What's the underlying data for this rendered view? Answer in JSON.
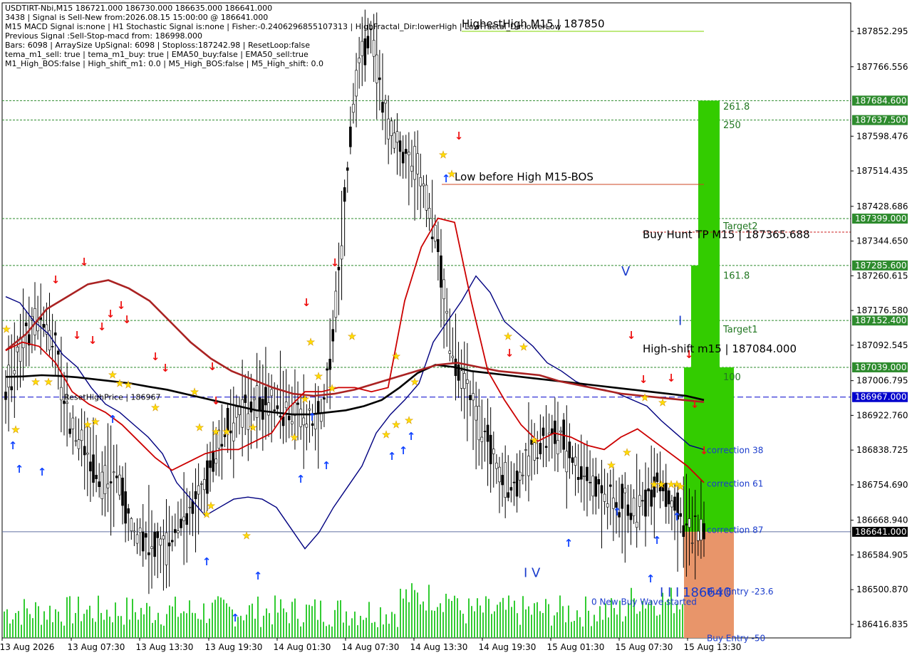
{
  "info_panel": [
    "USDTIRT-Nbi,M15  186721.000 186730.000 186635.000 186641.000",
    "3438 | Signal is Sell-New from:2026.08.15 15:00:00 @ 186641.000",
    "M15 MACD Signal is:none | H1 Stochastic Signal is:none | Fisher:-0.2406296855107313 | HighFractal_Dir:lowerHigh | LowFractal_Dir:lowerLow",
    "Previous Signal :Sell-Stop-macd from: 186998.000",
    "Bars: 6098 | ArraySize UpSignal: 6098 | Stoploss:187242.98 | ResetLoop:false",
    "tema_m1_sell: true | tema_m1_buy: true | EMA50_buy:false | EMA50_sell:true",
    "M1_High_BOS:false | High_shift_m1: 0.0 | M5_High_BOS:false | M5_High_shift: 0.0"
  ],
  "colors": {
    "background": "#ffffff",
    "grid_green": "#2e8b2e",
    "current_price_tag": "#000000",
    "ref_price_tag": "#0000cc",
    "target_tag": "#2e8b2e",
    "candle": "#000000",
    "ema_red": "#cc0000",
    "ema_dark_red": "#aa2222",
    "ema_blue": "#000080",
    "ema_black": "#000000",
    "volume": "#33cc33",
    "buy_arrow": "#1144ff",
    "sell_arrow": "#ee1111",
    "star": "#ffdd00",
    "fib_green": "#33cc00",
    "fib_orange": "#e8956a"
  },
  "icons": {
    "buy_arrow": "up-arrow-icon",
    "sell_arrow": "down-arrow-icon",
    "fractal_star": "star-icon"
  },
  "chart_data": {
    "type": "candlestick",
    "symbol": "USDTIRT-Nbi",
    "timeframe": "M15",
    "ylim": [
      186380,
      187930
    ],
    "y_ticks": [
      187852.295,
      187766.556,
      187598.476,
      187514.435,
      187428.686,
      187344.65,
      187260.615,
      187176.58,
      187092.545,
      187006.795,
      186922.76,
      186838.725,
      186754.69,
      186668.94,
      186584.905,
      186500.87,
      186416.835
    ],
    "y_tick_labels": [
      "187852.295",
      "187766.556",
      "187598.476",
      "187514.435",
      "187428.686",
      "187344.650",
      "187260.615",
      "187176.580",
      "187092.545",
      "187006.795",
      "186922.760",
      "186838.725",
      "186754.690",
      "186668.940",
      "186584.905",
      "186500.870",
      "186416.835"
    ],
    "x_labels": [
      "13 Aug 2026",
      "13 Aug 07:30",
      "13 Aug 13:30",
      "13 Aug 19:30",
      "14 Aug 01:30",
      "14 Aug 07:30",
      "14 Aug 13:30",
      "14 Aug 19:30",
      "15 Aug 01:30",
      "15 Aug 07:30",
      "15 Aug 13:30"
    ],
    "price_tags": [
      {
        "value": 187684.6,
        "label": "187684.600",
        "kind": "target"
      },
      {
        "value": 187637.5,
        "label": "187637.500",
        "kind": "target"
      },
      {
        "value": 187399.0,
        "label": "187399.000",
        "kind": "target"
      },
      {
        "value": 187285.6,
        "label": "187285.600",
        "kind": "target"
      },
      {
        "value": 187152.4,
        "label": "187152.400",
        "kind": "target"
      },
      {
        "value": 187039.0,
        "label": "187039.000",
        "kind": "target"
      },
      {
        "value": 186967.0,
        "label": "186967.000",
        "kind": "reference"
      },
      {
        "value": 186641.0,
        "label": "186641.000",
        "kind": "current"
      }
    ],
    "fib_levels": [
      {
        "value": 187670,
        "label": "261.8"
      },
      {
        "value": 187625,
        "label": "250"
      },
      {
        "value": 187380,
        "label": "Target2"
      },
      {
        "value": 187260,
        "label": "161.8"
      },
      {
        "value": 187130,
        "label": "Target1"
      },
      {
        "value": 187015,
        "label": "100"
      },
      {
        "value": 186838,
        "label": "correction 38"
      },
      {
        "value": 186757,
        "label": "correction 61"
      },
      {
        "value": 186645,
        "label": "correction 87"
      },
      {
        "value": 186496,
        "label": "Buy Entry -23.6"
      },
      {
        "value": 186383,
        "label": "Buy Entry -50"
      }
    ],
    "annotations": [
      {
        "text": "HighestHigh    M15 | 187850",
        "x": 648,
        "value": 187870
      },
      {
        "text": "Low before High    M15-BOS",
        "x": 638,
        "value": 187500
      },
      {
        "text": "Buy Hunt TP M15 | 187365.688",
        "x": 902,
        "value": 187360
      },
      {
        "text": "High-shift m15 | 187084.000",
        "x": 902,
        "value": 187084
      },
      {
        "text": "ResetHighPrice | 186967",
        "x": 90,
        "value": 186969
      },
      {
        "text": "V",
        "x": 872,
        "value": 187270
      },
      {
        "text": "I",
        "x": 952,
        "value": 187150
      },
      {
        "text": "I V",
        "x": 735,
        "value": 186540
      },
      {
        "text": "I I I",
        "x": 926,
        "value": 186493
      },
      {
        "text": "186640",
        "x": 958,
        "value": 186493
      },
      {
        "text": "0 New Buy Wave started",
        "x": 830,
        "value": 186473
      }
    ],
    "series": [
      {
        "kind": "ema",
        "color_key": "ema_blue",
        "values": [
          187210,
          187195,
          187150,
          187120,
          187070,
          187040,
          186990,
          186950,
          186930,
          186900,
          186870,
          186830,
          186760,
          186720,
          186680,
          186700,
          186720,
          186725,
          186720,
          186700,
          186650,
          186600,
          186640,
          186700,
          186750,
          186800,
          186880,
          186925,
          186960,
          187000,
          187100,
          187150,
          187200,
          187260,
          187220,
          187150,
          187120,
          187090,
          187050,
          187030,
          187005,
          186990,
          186985,
          186975,
          186960,
          186945,
          186910,
          186880,
          186850,
          186840
        ]
      },
      {
        "kind": "ema",
        "color_key": "ema_black",
        "values": [
          187016,
          187017,
          187020,
          187018,
          187015,
          187010,
          187005,
          187000,
          186992,
          186985,
          186975,
          186965,
          186955,
          186945,
          186935,
          186930,
          186925,
          186925,
          186930,
          186935,
          186945,
          186960,
          186990,
          187025,
          187045,
          187040,
          187030,
          187025,
          187020,
          187015,
          187010,
          187005,
          187000,
          186995,
          186990,
          186985,
          186980,
          186975,
          186970,
          186960
        ]
      },
      {
        "kind": "ema",
        "color_key": "ema_dark_red",
        "values": [
          187080,
          187120,
          187180,
          187210,
          187240,
          187250,
          187230,
          187200,
          187150,
          187100,
          187060,
          187030,
          187010,
          186990,
          186975,
          186970,
          186975,
          186985,
          187000,
          187015,
          187030,
          187045,
          187050,
          187040,
          187030,
          187025,
          187020,
          187005,
          186995,
          186985,
          186975,
          186970,
          186965,
          186960,
          186955
        ]
      },
      {
        "kind": "ema",
        "color_key": "ema_red",
        "values": [
          187080,
          187100,
          187090,
          187050,
          186980,
          186950,
          186930,
          186900,
          186860,
          186820,
          186790,
          186810,
          186830,
          186840,
          186840,
          186860,
          186880,
          186940,
          186980,
          186980,
          186990,
          186990,
          186980,
          186990,
          187200,
          187330,
          187400,
          187390,
          187200,
          187030,
          186960,
          186900,
          186860,
          186880,
          186870,
          186850,
          186840,
          186870,
          186890,
          186860,
          186830,
          186800,
          186760
        ]
      },
      {
        "kind": "price",
        "color_key": "candle",
        "values": [
          186980,
          187100,
          187160,
          187120,
          186900,
          186850,
          186760,
          186780,
          186640,
          186620,
          186600,
          186670,
          186700,
          186810,
          186900,
          186940,
          186960,
          186950,
          186930,
          186910,
          186920,
          187250,
          187730,
          187850,
          187640,
          187550,
          187520,
          187380,
          187100,
          186980,
          186900,
          186780,
          186750,
          186830,
          186860,
          186870,
          186800,
          186760,
          186720,
          186700,
          186700,
          186780,
          186700,
          186650,
          186641
        ]
      }
    ]
  }
}
